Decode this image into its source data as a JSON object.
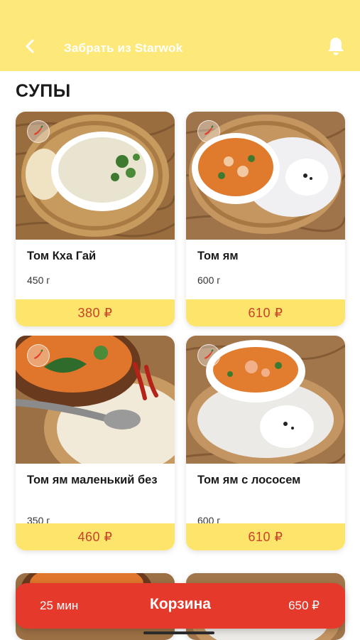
{
  "header": {
    "title": "Забрать из Starwok",
    "back_icon": "chevron-left-icon",
    "bell_icon": "bell-icon",
    "background_color": "#fde87a"
  },
  "section": {
    "title": "СУПЫ"
  },
  "products": [
    {
      "name": "Том Кха Гай",
      "weight": "450 г",
      "price": "380 ₽"
    },
    {
      "name": "Том ям",
      "weight": "600 г",
      "price": "610 ₽"
    },
    {
      "name": "Том ям маленький без",
      "weight": "350 г",
      "price": "460 ₽"
    },
    {
      "name": "Том ям с лососем",
      "weight": "600 г",
      "price": "610 ₽"
    }
  ],
  "cart": {
    "time": "25 мин",
    "label": "Корзина",
    "sum": "650 ₽",
    "color": "#e53a2b"
  },
  "colors": {
    "price_bg": "#fde46a",
    "price_text": "#c7432b"
  }
}
